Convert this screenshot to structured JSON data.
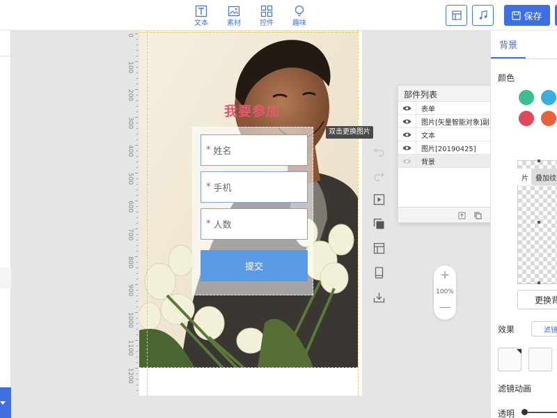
{
  "toolbar": {
    "items": [
      {
        "label": "文本",
        "icon": "text-icon"
      },
      {
        "label": "素材",
        "icon": "image-icon"
      },
      {
        "label": "控件",
        "icon": "widgets-icon"
      },
      {
        "label": "趣味",
        "icon": "bulb-icon"
      }
    ],
    "save_label": "保存"
  },
  "ruler": {
    "marks": [
      "0",
      "100",
      "200",
      "300",
      "400",
      "500",
      "600",
      "700",
      "800",
      "900",
      "1000",
      "1100",
      "1200"
    ]
  },
  "canvas": {
    "headline": "我要参加",
    "fields": [
      {
        "required_mark": "*",
        "placeholder": "姓名"
      },
      {
        "required_mark": "*",
        "placeholder": "手机"
      },
      {
        "required_mark": "*",
        "placeholder": "人数"
      }
    ],
    "submit_label": "提交",
    "tooltip": "双击更换图片"
  },
  "zoom": {
    "plus": "+",
    "value": "100%",
    "minus": "—"
  },
  "layers_panel": {
    "title": "部件列表",
    "close": "✕",
    "items": [
      {
        "name": "表单",
        "selected": false
      },
      {
        "name": "图片[矢量智能对象]副本",
        "selected": false
      },
      {
        "name": "文本",
        "selected": false
      },
      {
        "name": "图片[20190425]",
        "selected": false
      },
      {
        "name": "背景",
        "selected": true
      }
    ]
  },
  "right_panel": {
    "tab_label": "背景",
    "color_label": "颜色",
    "swatches": [
      "#3cbf8f",
      "#39aee0",
      "#e0485c",
      "#e8603c"
    ],
    "subtab_partial": "片",
    "subtab_active": "叠加纹",
    "replace_label": "更换背",
    "effect_label": "效果",
    "filter_label": "滤镜",
    "filter_anim_label": "滤镜动画",
    "opacity_label": "透明"
  },
  "colors": {
    "accent": "#3d6fe0",
    "title_text": "#e05a6a",
    "submit_bg": "#5b9be6",
    "required": "#e03c3c"
  }
}
